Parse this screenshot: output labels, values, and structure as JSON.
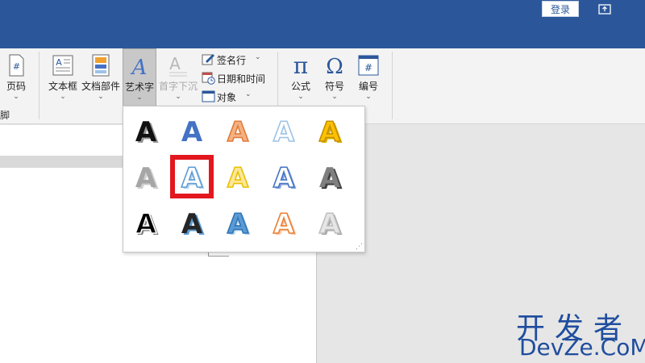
{
  "titlebar": {
    "login_label": "登录"
  },
  "ribbon": {
    "page_number_label": "页码",
    "textbox_label": "文本框",
    "doc_parts_label": "文档部件",
    "wordart_label": "艺术字",
    "dropcap_label": "首字下沉",
    "signature_label": "签名行",
    "datetime_label": "日期和时间",
    "object_label": "对象",
    "formula_label": "公式",
    "symbol_label": "符号",
    "numbering_label": "编号",
    "group_fragment": "脚",
    "chevron": "⌄"
  },
  "gallery": {
    "glyph": "A",
    "selected_index": 6,
    "styles": [
      {
        "name": "wordart-black-shadow",
        "fill": "#111111",
        "stroke": "none",
        "shadow": "#999999"
      },
      {
        "name": "wordart-blue-fill",
        "fill": "#4472c4",
        "stroke": "none",
        "shadow": "none"
      },
      {
        "name": "wordart-orange-outline",
        "fill": "#f4b183",
        "stroke": "#e07b39",
        "shadow": "none"
      },
      {
        "name": "wordart-white-outline-blue",
        "fill": "#ffffff",
        "stroke": "#9dc3e6",
        "shadow": "none"
      },
      {
        "name": "wordart-gold",
        "fill": "#ffc000",
        "stroke": "#c09000",
        "shadow": "#e0b000"
      },
      {
        "name": "wordart-gray",
        "fill": "#a6a6a6",
        "stroke": "none",
        "shadow": "#d0d0d0"
      },
      {
        "name": "wordart-blue-reflection",
        "fill": "#ffffff",
        "stroke": "#5b9bd5",
        "shadow": "#bdd7ee"
      },
      {
        "name": "wordart-yellow-outline",
        "fill": "#ffe699",
        "stroke": "#e6c200",
        "shadow": "none"
      },
      {
        "name": "wordart-white-blue-outline",
        "fill": "#ffffff",
        "stroke": "#4472c4",
        "shadow": "#8faadc"
      },
      {
        "name": "wordart-gray-gradient",
        "fill": "#7f7f7f",
        "stroke": "none",
        "shadow": "#404040"
      },
      {
        "name": "wordart-black-white-shadow",
        "fill": "#000000",
        "stroke": "#ffffff",
        "shadow": "#7f7f7f"
      },
      {
        "name": "wordart-dark-blue-shadow",
        "fill": "#262626",
        "stroke": "none",
        "shadow": "#5b9bd5"
      },
      {
        "name": "wordart-blue-bevel",
        "fill": "#5b9bd5",
        "stroke": "#2e75b6",
        "shadow": "#bdd7ee"
      },
      {
        "name": "wordart-orange-bevel",
        "fill": "#ffffff",
        "stroke": "#ed7d31",
        "shadow": "#f8cbad"
      },
      {
        "name": "wordart-silver",
        "fill": "#e7e6e6",
        "stroke": "#bfbfbf",
        "shadow": "#a6a6a6"
      }
    ]
  },
  "watermark": {
    "line1": "开发者",
    "line2": "DevZe.CoM"
  }
}
